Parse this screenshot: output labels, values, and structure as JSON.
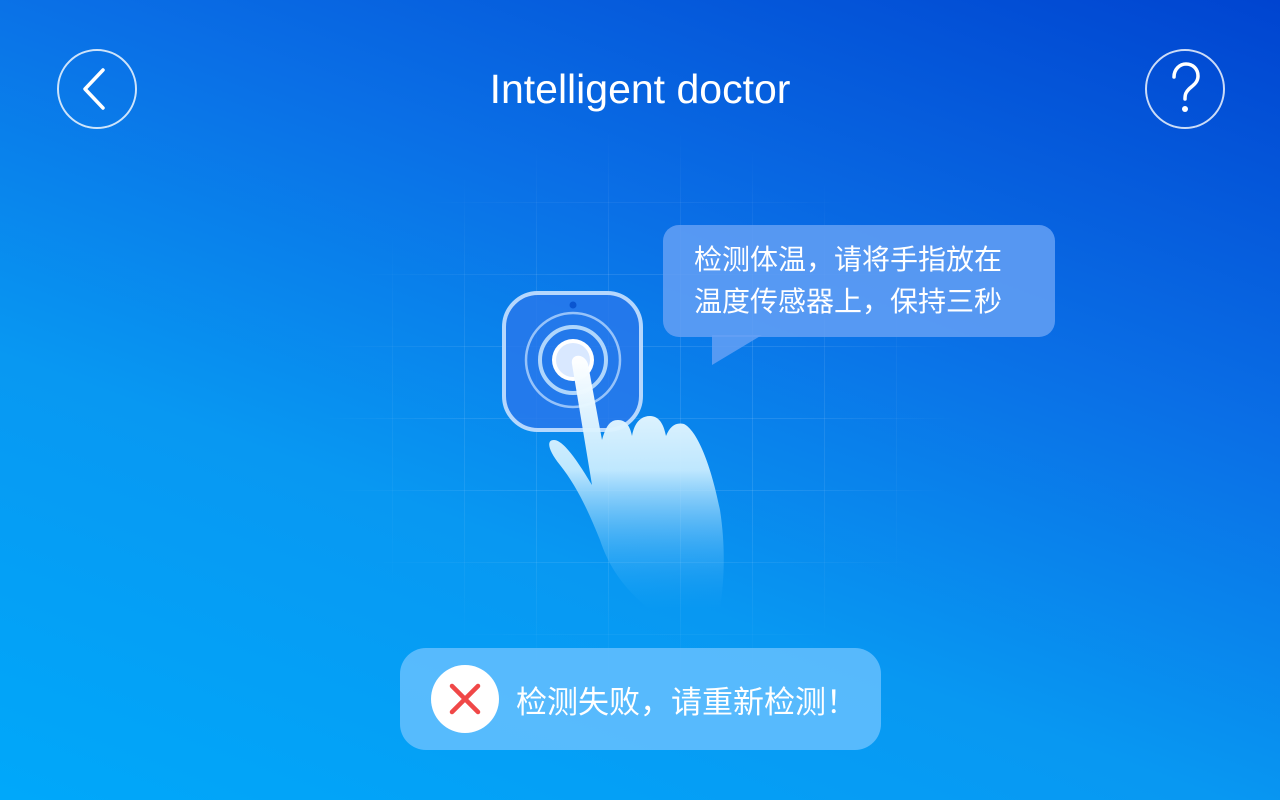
{
  "header": {
    "title": "Intelligent doctor",
    "back_icon": "chevron-left-icon",
    "help_icon": "question-mark-icon"
  },
  "instruction": {
    "line1": "检测体温，请将手指放在",
    "line2": "温度传感器上，保持三秒"
  },
  "illustration": {
    "sensor_icon": "fingerprint-sensor-icon",
    "hand_icon": "pointing-hand-icon"
  },
  "toast": {
    "icon": "close-icon",
    "message": "检测失败，请重新检测！",
    "icon_color": "#f04848"
  },
  "colors": {
    "background_top": "#0044d0",
    "background_bottom": "#00a8fa"
  }
}
